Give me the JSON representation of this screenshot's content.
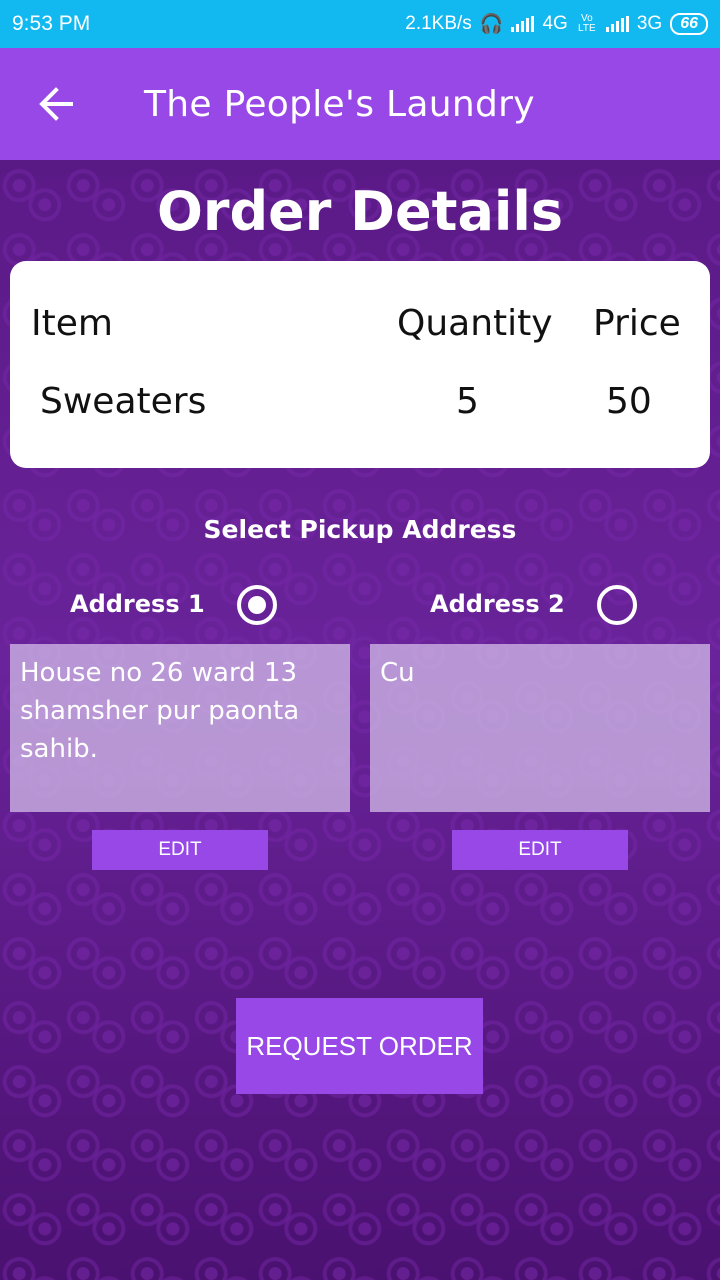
{
  "status_bar": {
    "time": "9:53 PM",
    "network_speed": "2.1KB/s",
    "headset_icon": "headset-icon",
    "net1": "4G",
    "volte": "Vo LTE",
    "net2": "3G",
    "battery": "66"
  },
  "appbar": {
    "back_icon": "arrow-left-icon",
    "title": "The People's Laundry"
  },
  "page": {
    "title": "Order Details"
  },
  "order_table": {
    "headers": [
      "Item",
      "Quantity",
      "Price"
    ],
    "rows": [
      {
        "item": "Sweaters",
        "quantity": "5",
        "price": "50"
      }
    ]
  },
  "pickup": {
    "label": "Select Pickup Address",
    "addresses": [
      {
        "label": "Address 1",
        "text": "House no 26 ward 13 shamsher pur paonta sahib.",
        "selected": true,
        "edit_label": "EDIT"
      },
      {
        "label": "Address 2",
        "text": "Cu",
        "selected": false,
        "edit_label": "EDIT"
      }
    ]
  },
  "actions": {
    "request_label": "REQUEST ORDER"
  },
  "colors": {
    "status_bar": "#12b9f1",
    "accent": "#9748e6",
    "background": "#5a1a86"
  }
}
